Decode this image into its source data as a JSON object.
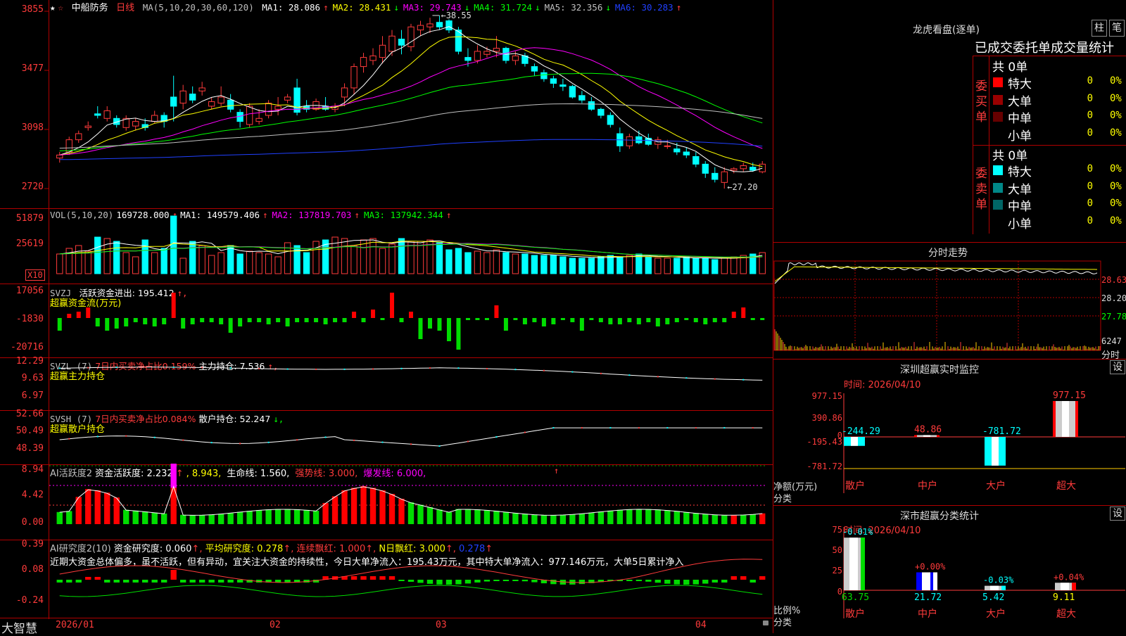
{
  "stock": {
    "star": "★",
    "name": "中船防务",
    "period": "日线"
  },
  "main": {
    "ma_header": "MA(5,10,20,30,60,120)",
    "ma": [
      {
        "label": "MA1: 28.086",
        "arrow": "↑",
        "color": "#ffffff"
      },
      {
        "label": "MA2: 28.431",
        "arrow": "↓",
        "color": "#ffff00"
      },
      {
        "label": "MA3: 29.743",
        "arrow": "↓",
        "color": "#ff00ff"
      },
      {
        "label": "MA4: 31.724",
        "arrow": "↓",
        "color": "#00ff00"
      },
      {
        "label": "MA5: 32.356",
        "arrow": "↓",
        "color": "#c0c0c0"
      },
      {
        "label": "MA6: 30.283",
        "arrow": "↑",
        "color": "#2040ff"
      }
    ],
    "yaxis": [
      "3855",
      "3477",
      "3098",
      "2720"
    ],
    "high_label": "38.55",
    "low_label": "←27.20"
  },
  "vol": {
    "header": "VOL(5,10,20)",
    "value": "169728.000",
    "arrow": "↑",
    "ma": [
      {
        "label": "MA1: 149579.406",
        "arrow": "↑",
        "color": "#ffffff"
      },
      {
        "label": "MA2: 137819.703",
        "arrow": "↑",
        "color": "#ff00ff"
      },
      {
        "label": "MA3: 137942.344",
        "arrow": "↑",
        "color": "#00ff00"
      }
    ],
    "yaxis": [
      "51879",
      "25619"
    ],
    "unit": "X10"
  },
  "svzj": {
    "title": "SVZJ",
    "item": "活跃资金进出: 195.412",
    "arrow": "↑,",
    "sub": "超赢资金流(万元)",
    "yaxis": [
      "17056",
      "-1830",
      "-20716"
    ]
  },
  "svzl": {
    "title": "SVZL (7)",
    "item1": "7日内买卖净占比0.159%",
    "item2": "主力持仓: 7.536",
    "arrow": "↑,",
    "sub": "超赢主力持仓",
    "yaxis": [
      "12.29",
      "9.63",
      "6.97"
    ]
  },
  "svsh": {
    "title": "SVSH (7)",
    "item1": "7日内买卖净占比0.084%",
    "item2": "散户持仓: 52.247",
    "arrow": "↓,",
    "sub": "超赢散户持仓",
    "yaxis": [
      "52.66",
      "50.49",
      "48.39"
    ]
  },
  "ai1": {
    "title": "AI活跃度2",
    "items": [
      {
        "t": "资金活跃度: 2.232",
        "c": "#ffffff"
      },
      {
        "t": "↑",
        "c": "#ff3b3b"
      },
      {
        "t": ", 8.943,",
        "c": "#ffff00"
      },
      {
        "t": " 生命线: 1.560,",
        "c": "#ffffff"
      },
      {
        "t": " 强势线: 3.000,",
        "c": "#ff3b3b"
      },
      {
        "t": " 爆发线: 6.000,",
        "c": "#ff00ff"
      }
    ],
    "arrow": "↑",
    "yaxis": [
      "8.94",
      "4.42",
      "0.00"
    ]
  },
  "ai2": {
    "title": "AI研究度2(10)",
    "items": [
      {
        "t": "资金研究度: 0.060",
        "c": "#ffffff"
      },
      {
        "t": "↑,",
        "c": "#ff3b3b"
      },
      {
        "t": " 平均研究度: 0.278",
        "c": "#ffff00"
      },
      {
        "t": "↑,",
        "c": "#ff3b3b"
      },
      {
        "t": " 连续飘红: 1.000",
        "c": "#ff3b3b"
      },
      {
        "t": "↑,",
        "c": "#ff3b3b"
      },
      {
        "t": " N日飘红: 3.000",
        "c": "#ffff00"
      },
      {
        "t": "↑,",
        "c": "#ff3b3b"
      },
      {
        "t": " 0.278",
        "c": "#2040ff"
      },
      {
        "t": "↑",
        "c": "#ff3b3b"
      }
    ],
    "comment": "近期大资金总体偏多，虽不活跃，但有异动，宜关注大资金的持续性，今日大单净流入：195.43万元，其中特大单净流入：977.146万元，大单5日累计净入",
    "yaxis": [
      "0.39",
      "0.08",
      "-0.24"
    ]
  },
  "bottom": {
    "logo": "大智慧",
    "dates": [
      "2026/01",
      "02",
      "03",
      "04"
    ]
  },
  "dragon": {
    "title": "龙虎看盘(逐单)",
    "btn1": "柱",
    "btn2": "笔",
    "header": "已成交委托单成交量统计",
    "buy": {
      "label": "委买单",
      "total": "共 0单",
      "rows": [
        {
          "name": "特大",
          "v": "0",
          "p": "0%",
          "color": "#ff0000"
        },
        {
          "name": "大单",
          "v": "0",
          "p": "0%",
          "color": "#990000"
        },
        {
          "name": "中单",
          "v": "0",
          "p": "0%",
          "color": "#660000"
        },
        {
          "name": "小单",
          "v": "0",
          "p": "0%",
          "color": ""
        }
      ]
    },
    "sell": {
      "label": "委卖单",
      "total": "共 0单",
      "rows": [
        {
          "name": "特大",
          "v": "0",
          "p": "0%",
          "color": "#00ffff"
        },
        {
          "name": "大单",
          "v": "0",
          "p": "0%",
          "color": "#008888"
        },
        {
          "name": "中单",
          "v": "0",
          "p": "0%",
          "color": "#006666"
        },
        {
          "name": "小单",
          "v": "0",
          "p": "0%",
          "color": ""
        }
      ]
    }
  },
  "intraday": {
    "title": "分时走势",
    "labels": [
      "28.63",
      "28.20",
      "27.78",
      "6247",
      "分时"
    ]
  },
  "sz_monitor": {
    "title": "深圳超赢实时监控",
    "btn": "设",
    "time": "时间: 2026/04/10",
    "yaxis": [
      "977.15",
      "390.86",
      "0",
      "-195.43",
      "-781.72"
    ],
    "ylabel": "净额(万元)",
    "xlabel": "分类",
    "cats": [
      "散户",
      "中户",
      "大户",
      "超大"
    ],
    "values": [
      -244.29,
      48.86,
      -781.72,
      977.15
    ],
    "labels": [
      "-244.29",
      "48.86",
      "-781.72",
      "977.15"
    ]
  },
  "sz_class": {
    "title": "深市超赢分类统计",
    "btn": "设",
    "time": "时间: 2026/04/10",
    "yaxis": [
      "75",
      "50",
      "25",
      "0"
    ],
    "ylabel": "比例%",
    "xlabel": "分类",
    "cats": [
      "散户",
      "中户",
      "大户",
      "超大"
    ],
    "values": [
      63.75,
      21.72,
      5.42,
      9.11
    ],
    "bottom_labels": [
      "63.75",
      "21.72",
      "5.42",
      "9.11"
    ],
    "top_labels": [
      "-0.01%",
      "+0.00%",
      "-0.03%",
      "+0.04%"
    ]
  },
  "chart_data": {
    "type": "candlestick",
    "price_ylim": [
      27.2,
      38.55
    ],
    "candles": [
      [
        29.2,
        29.6,
        28.9,
        29.4
      ],
      [
        29.6,
        30.6,
        29.4,
        30.4
      ],
      [
        30.4,
        31.0,
        30.2,
        30.8
      ],
      [
        31.2,
        31.6,
        31.0,
        31.3
      ],
      [
        32.1,
        32.6,
        31.8,
        32.0
      ],
      [
        31.8,
        32.6,
        31.6,
        32.3
      ],
      [
        31.8,
        32.0,
        31.2,
        31.4
      ],
      [
        31.2,
        32.0,
        31.0,
        31.8
      ],
      [
        31.3,
        31.8,
        31.0,
        31.6
      ],
      [
        31.4,
        31.8,
        31.0,
        31.2
      ],
      [
        31.6,
        32.3,
        31.5,
        32.0
      ],
      [
        32.0,
        32.2,
        31.2,
        31.6
      ],
      [
        33.2,
        34.6,
        31.6,
        32.6
      ],
      [
        32.8,
        34.0,
        32.4,
        33.6
      ],
      [
        33.4,
        33.9,
        32.8,
        33.0
      ],
      [
        33.6,
        34.2,
        33.3,
        33.8
      ],
      [
        32.6,
        33.2,
        32.4,
        32.9
      ],
      [
        32.8,
        33.9,
        32.6,
        33.2
      ],
      [
        33.0,
        33.4,
        32.2,
        32.4
      ],
      [
        32.2,
        32.4,
        31.2,
        31.6
      ],
      [
        31.4,
        32.8,
        31.2,
        32.6
      ],
      [
        31.6,
        32.4,
        31.4,
        31.8
      ],
      [
        32.0,
        33.0,
        31.8,
        32.8
      ],
      [
        32.4,
        33.2,
        32.0,
        32.6
      ],
      [
        33.0,
        33.4,
        32.8,
        33.2
      ],
      [
        33.8,
        34.4,
        32.0,
        32.2
      ],
      [
        32.6,
        33.0,
        32.2,
        32.4
      ],
      [
        32.4,
        33.1,
        32.3,
        32.9
      ],
      [
        32.6,
        33.2,
        32.3,
        32.4
      ],
      [
        32.4,
        32.8,
        32.2,
        32.6
      ],
      [
        33.2,
        34.1,
        32.6,
        33.8
      ],
      [
        33.8,
        35.4,
        33.4,
        35.2
      ],
      [
        35.2,
        36.1,
        34.8,
        35.8
      ],
      [
        35.6,
        36.4,
        35.3,
        35.9
      ],
      [
        35.8,
        37.2,
        35.4,
        36.6
      ],
      [
        36.2,
        37.6,
        35.9,
        37.2
      ],
      [
        37.0,
        37.6,
        36.0,
        36.6
      ],
      [
        36.5,
        38.0,
        36.2,
        37.8
      ],
      [
        37.6,
        38.2,
        37.2,
        37.9
      ],
      [
        37.8,
        38.4,
        37.4,
        38.0
      ],
      [
        38.1,
        38.55,
        37.6,
        37.8
      ],
      [
        38.2,
        38.3,
        37.4,
        37.6
      ],
      [
        37.6,
        37.8,
        36.0,
        36.2
      ],
      [
        35.8,
        36.4,
        35.2,
        35.6
      ],
      [
        35.6,
        36.6,
        35.4,
        36.2
      ],
      [
        36.0,
        36.5,
        35.8,
        36.2
      ],
      [
        36.2,
        37.2,
        35.8,
        36.4
      ],
      [
        36.4,
        36.5,
        35.4,
        35.6
      ],
      [
        35.6,
        36.2,
        35.3,
        35.9
      ],
      [
        35.9,
        36.1,
        35.2,
        35.4
      ],
      [
        35.2,
        35.4,
        34.6,
        34.9
      ],
      [
        34.8,
        35.0,
        34.2,
        34.4
      ],
      [
        34.4,
        34.6,
        33.8,
        34.1
      ],
      [
        34.0,
        34.4,
        33.6,
        33.9
      ],
      [
        33.9,
        34.0,
        33.1,
        33.2
      ],
      [
        33.3,
        33.6,
        32.8,
        33.0
      ],
      [
        32.9,
        33.2,
        32.3,
        32.4
      ],
      [
        32.4,
        32.5,
        31.8,
        32.0
      ],
      [
        32.0,
        32.2,
        31.2,
        31.4
      ],
      [
        30.8,
        31.2,
        29.6,
        30.0
      ],
      [
        30.0,
        30.8,
        29.8,
        30.6
      ],
      [
        30.6,
        31.0,
        30.1,
        30.2
      ],
      [
        30.5,
        30.8,
        30.0,
        30.1
      ],
      [
        30.1,
        30.6,
        29.8,
        30.4
      ],
      [
        30.0,
        30.4,
        29.8,
        30.0
      ],
      [
        29.8,
        30.2,
        29.4,
        29.6
      ],
      [
        29.6,
        29.9,
        29.2,
        29.4
      ],
      [
        29.3,
        29.6,
        28.6,
        28.8
      ],
      [
        28.8,
        29.0,
        27.9,
        28.2
      ],
      [
        28.2,
        28.6,
        27.6,
        27.8
      ],
      [
        27.6,
        28.6,
        27.2,
        28.3
      ],
      [
        28.4,
        28.6,
        28.2,
        28.5
      ],
      [
        28.5,
        28.9,
        28.3,
        28.7
      ],
      [
        28.6,
        28.9,
        28.3,
        28.4
      ],
      [
        28.3,
        29.0,
        28.2,
        28.8
      ]
    ],
    "volume": [
      28,
      36,
      40,
      32,
      52,
      50,
      46,
      30,
      24,
      48,
      30,
      36,
      82,
      22,
      46,
      40,
      26,
      30,
      40,
      28,
      32,
      30,
      28,
      24,
      44,
      40,
      30,
      46,
      48,
      52,
      50,
      40,
      48,
      50,
      36,
      42,
      50,
      46,
      46,
      48,
      44,
      34,
      36,
      30,
      32,
      30,
      34,
      30,
      28,
      28,
      26,
      26,
      26,
      24,
      22,
      22,
      22,
      24,
      26,
      24,
      26,
      28,
      24,
      22,
      22,
      22,
      24,
      22,
      22,
      20,
      22,
      24,
      26,
      28,
      30
    ],
    "svzj": [
      -6,
      2,
      3,
      5,
      -4,
      -6,
      -5,
      -4,
      -2,
      -3,
      -4,
      -3,
      12,
      -5,
      -3,
      -2,
      -2,
      -3,
      -7,
      -4,
      -2,
      -2,
      -3,
      -2,
      -4,
      -2,
      -2,
      -2,
      -3,
      -2,
      -2,
      3,
      -2,
      4,
      -1,
      12,
      -2,
      3,
      -10,
      -5,
      -6,
      -11,
      -15,
      -1,
      -1,
      -1,
      6,
      -6,
      -1,
      -3,
      -2,
      -4,
      -3,
      -1,
      -2,
      -6,
      -1,
      -2,
      -3,
      -3,
      -2,
      -3,
      -2,
      -4,
      -3,
      -2,
      -1,
      -2,
      -3,
      -2,
      -2,
      3,
      5,
      -1,
      -1
    ]
  }
}
